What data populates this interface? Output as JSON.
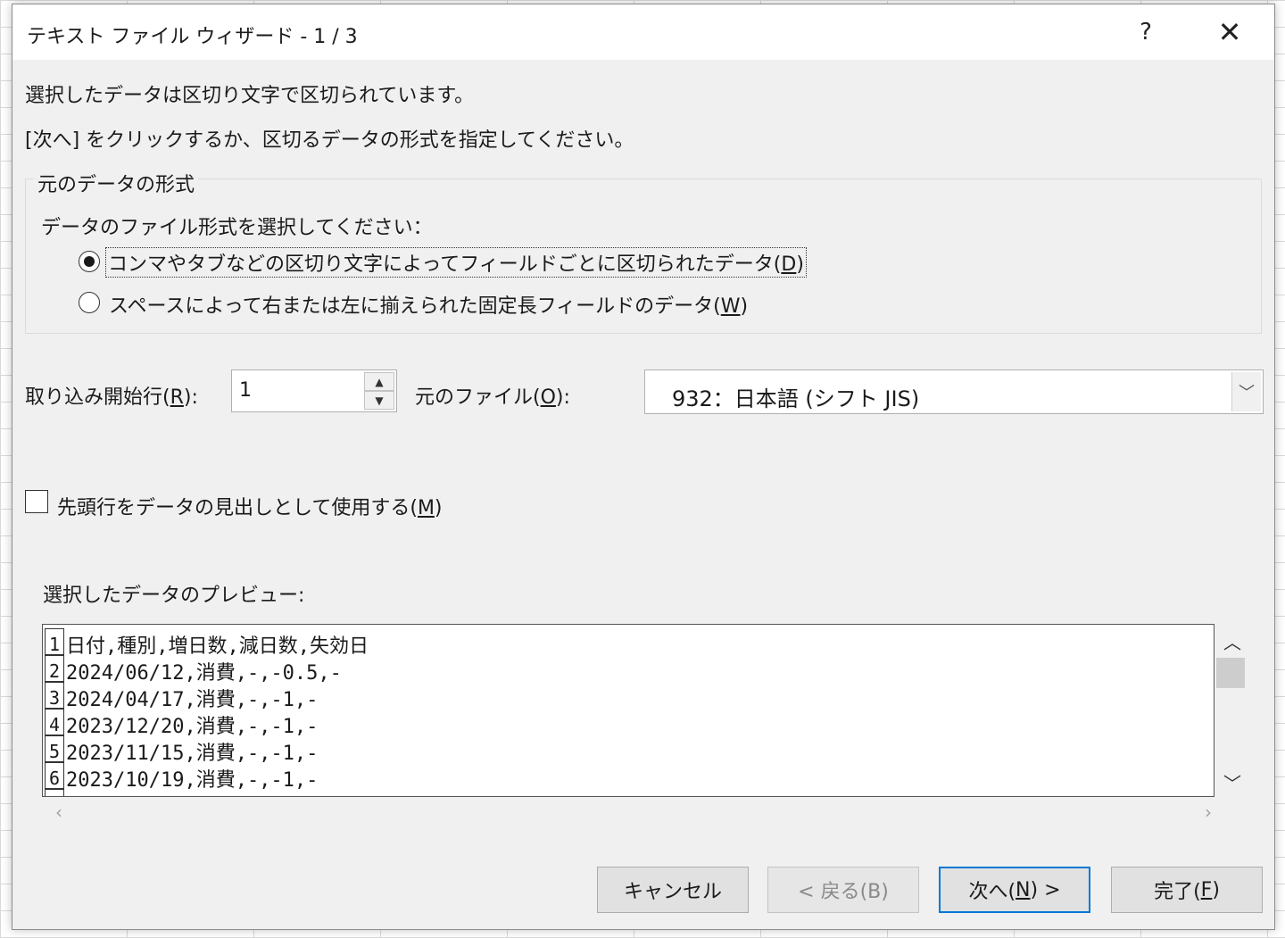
{
  "dialog": {
    "title": "テキスト ファイル ウィザード - 1 / 3",
    "help_label": "?",
    "close_label": "✕"
  },
  "intro": {
    "line1": "選択したデータは区切り文字で区切られています。",
    "line2": "[次へ] をクリックするか、区切るデータの形式を指定してください。"
  },
  "format_group": {
    "legend": "元のデータの形式",
    "prompt": "データのファイル形式を選択してください：",
    "options": [
      {
        "label_before": "コンマやタブなどの区切り文字によってフィールドごとに区切られたデータ(",
        "accel": "D",
        "label_after": ")",
        "selected": true
      },
      {
        "label_before": "スペースによって右または左に揃えられた固定長フィールドのデータ(",
        "accel": "W",
        "label_after": ")",
        "selected": false
      }
    ]
  },
  "start_row": {
    "label_before": "取り込み開始行(",
    "accel": "R",
    "label_after": "):",
    "value": "1"
  },
  "file_origin": {
    "label_before": "元のファイル(",
    "accel": "O",
    "label_after": "):",
    "value": "932：日本語 (シフト JIS)"
  },
  "header_checkbox": {
    "label_before": "先頭行をデータの見出しとして使用する(",
    "accel": "M",
    "label_after": ")",
    "checked": false
  },
  "preview": {
    "label": "選択したデータのプレビュー:",
    "rows": [
      {
        "num": "1",
        "text": "日付,種別,増日数,減日数,失効日"
      },
      {
        "num": "2",
        "text": "2024/06/12,消費,-,-0.5,-"
      },
      {
        "num": "3",
        "text": "2024/04/17,消費,-,-1,-"
      },
      {
        "num": "4",
        "text": "2023/12/20,消費,-,-1,-"
      },
      {
        "num": "5",
        "text": "2023/11/15,消費,-,-1,-"
      },
      {
        "num": "6",
        "text": "2023/10/19,消費,-,-1,-"
      },
      {
        "num": "",
        "text": ""
      }
    ]
  },
  "buttons": {
    "cancel": "キャンセル",
    "back": {
      "before": "< 戻る(B)",
      "accel": "",
      "after": ""
    },
    "next": {
      "before": "次へ(",
      "accel": "N",
      "after": ") >"
    },
    "finish": {
      "before": "完了(",
      "accel": "F",
      "after": ")"
    }
  },
  "colors": {
    "dialog_bg": "#f0f0f0",
    "default_button_border": "#0078d7"
  },
  "icons": {
    "spin_up": "▲",
    "spin_down": "▼",
    "select_arrow": "﹀",
    "scroll_up": "︿",
    "scroll_down": "﹀",
    "scroll_left": "‹",
    "scroll_right": "›"
  }
}
